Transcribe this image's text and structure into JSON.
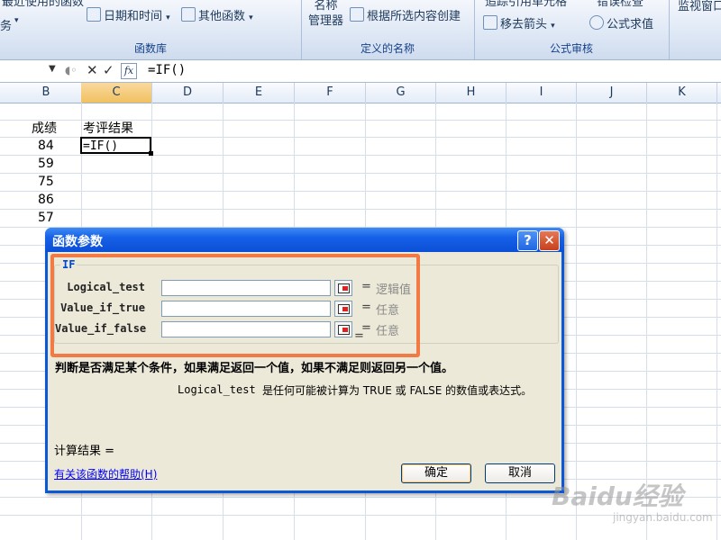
{
  "ribbon": {
    "row1_partial_left": "最近使用的函数",
    "row1_partial_right": "追踪引用单元格",
    "row1_partial_right2": "错误检查",
    "row1_partial_far": "监视窗口",
    "partial_left": "务",
    "datetime_label": "日期和时间",
    "other_funcs_label": "其他函数",
    "name_manager_line1": "名称",
    "name_manager_line2": "管理器",
    "create_from_sel_label": "根据所选内容创建",
    "remove_arrows_label": "移去箭头",
    "eval_formula_label": "公式求值",
    "group_function_lib": "函数库",
    "group_defined_names": "定义的名称",
    "group_formula_audit": "公式审核"
  },
  "formula_bar": {
    "cancel_glyph": "✕",
    "enter_glyph": "✓",
    "fx_glyph": "fx",
    "formula": "=IF()"
  },
  "columns": [
    "B",
    "C",
    "D",
    "E",
    "F",
    "G",
    "H",
    "I",
    "J",
    "K"
  ],
  "active_column": "C",
  "sheet": {
    "header_b": "成绩",
    "header_c": "考评结果",
    "scores": [
      "84",
      "59",
      "75",
      "86",
      "57"
    ],
    "active_cell_value": "=IF()"
  },
  "dialog": {
    "title": "函数参数",
    "help_glyph": "?",
    "close_glyph": "✕",
    "function_name": "IF",
    "args": [
      {
        "label": "Logical_test",
        "eq": "=",
        "hint": "逻辑值"
      },
      {
        "label": "Value_if_true",
        "eq": "=",
        "hint": "任意"
      },
      {
        "label": "Value_if_false",
        "eq": "=",
        "hint": "任意"
      }
    ],
    "result_eq": "=",
    "description": "判断是否满足某个条件，如果满足返回一个值，如果不满足则返回另一个值。",
    "arg_desc_name": "Logical_test",
    "arg_desc_text": "是任何可能被计算为 TRUE 或 FALSE 的数值或表达式。",
    "calc_result": "计算结果 =",
    "help_link": "有关该函数的帮助(H)",
    "ok": "确定",
    "cancel": "取消"
  },
  "watermark": {
    "main": "Baidu经验",
    "sub": "jingyan.baidu.com"
  },
  "colors": {
    "highlight": "#f27a45",
    "title_bar": "#0b4fd6",
    "dialog_bg": "#ece9d8",
    "legend_text": "#0046d5"
  }
}
